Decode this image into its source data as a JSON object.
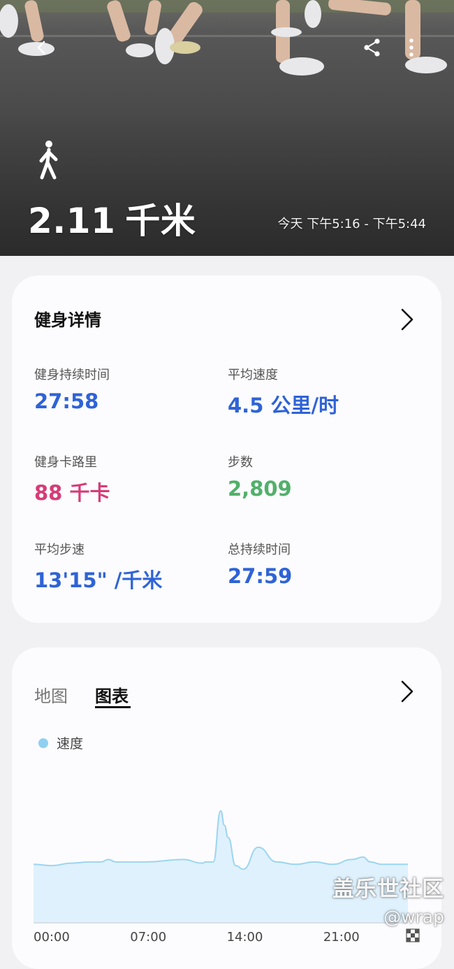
{
  "hero": {
    "distance_value": "2.11",
    "distance_unit": "千米",
    "time_range": "今天 下午5:16 - 下午5:44",
    "icons": {
      "back": "back-arrow-icon",
      "share": "share-icon",
      "more": "more-vert-icon",
      "activity": "walking-icon"
    }
  },
  "details": {
    "title": "健身详情",
    "metrics": [
      {
        "label": "健身持续时间",
        "value": "27:58",
        "color": "#2f63d6"
      },
      {
        "label": "平均速度",
        "value": "4.5 公里/时",
        "color": "#2f63d6"
      },
      {
        "label": "健身卡路里",
        "value": "88 千卡",
        "color": "#d63c78"
      },
      {
        "label": "步数",
        "value": "2,809",
        "color": "#52b06a"
      },
      {
        "label": "平均步速",
        "value": "13'15\" /千米",
        "color": "#2f63d6"
      },
      {
        "label": "总持续时间",
        "value": "27:59",
        "color": "#2f63d6"
      }
    ]
  },
  "chart_card": {
    "tabs": [
      {
        "label": "地图",
        "selected": false
      },
      {
        "label": "图表",
        "selected": true
      }
    ]
  },
  "chart_data": {
    "type": "area",
    "series": [
      {
        "name": "速度",
        "color": "#8fd0f0",
        "x_fraction": [
          0,
          0.05,
          0.1,
          0.15,
          0.18,
          0.2,
          0.22,
          0.3,
          0.4,
          0.45,
          0.46,
          0.48,
          0.5,
          0.51,
          0.52,
          0.54,
          0.56,
          0.6,
          0.65,
          0.7,
          0.75,
          0.8,
          0.85,
          0.88,
          0.9,
          0.93,
          1.0
        ],
        "values": [
          24,
          23.5,
          24.5,
          25,
          25,
          26,
          25,
          25,
          26,
          24.5,
          25,
          25,
          46,
          40,
          35,
          23.5,
          22,
          31,
          25,
          24,
          25,
          24,
          26,
          27,
          25,
          24,
          24
        ]
      }
    ],
    "xticks": [
      "00:00",
      "07:00",
      "14:00",
      "21:00"
    ],
    "ylim": [
      0,
      70
    ],
    "legend": "top-left",
    "grid": false,
    "end_marker": "finish-flag-icon"
  },
  "watermark": {
    "line1": "盖乐世社区",
    "line2": "@wrap"
  }
}
